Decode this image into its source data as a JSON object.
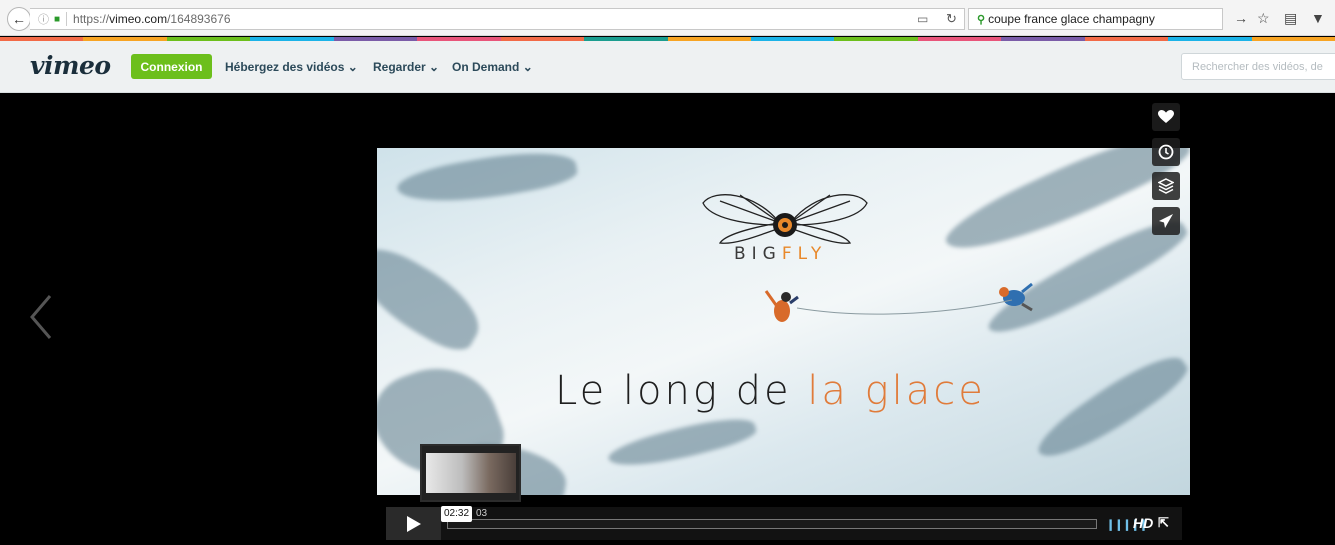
{
  "browser": {
    "url_prefix": "https://",
    "url_host": "vimeo.com",
    "url_path": "/164893676",
    "search_query": "coupe france glace champagny"
  },
  "stripe_colors": [
    "#f26a47",
    "#f7a423",
    "#6cbf1c",
    "#1bb3e8",
    "#7a5ca8",
    "#e8557a",
    "#f26a47",
    "#1a9d8f",
    "#f7a423",
    "#1bb3e8",
    "#6cbf1c",
    "#e8557a",
    "#7a5ca8",
    "#f26a47",
    "#1bb3e8",
    "#f7a423"
  ],
  "vimeo_header": {
    "logo": "vimeo",
    "login_label": "Connexion",
    "nav": [
      "Hébergez des vidéos",
      "Regarder",
      "On Demand"
    ],
    "search_placeholder": "Rechercher des vidéos, de"
  },
  "video": {
    "brand_prefix": "BIG",
    "brand_suffix": "FLY",
    "title_dark": "Le long de ",
    "title_orange": "la glace",
    "hover_time": "02:32",
    "total_time_fragment": "03",
    "hd_label": "HD"
  },
  "colors": {
    "accent_green": "#6cbf1c",
    "orange": "#e07b3a",
    "vimeo_blue": "#1bb3e8"
  },
  "icons": {
    "like": "heart-icon",
    "watch_later": "clock-icon",
    "collections": "layers-icon",
    "share": "paper-plane-icon"
  }
}
